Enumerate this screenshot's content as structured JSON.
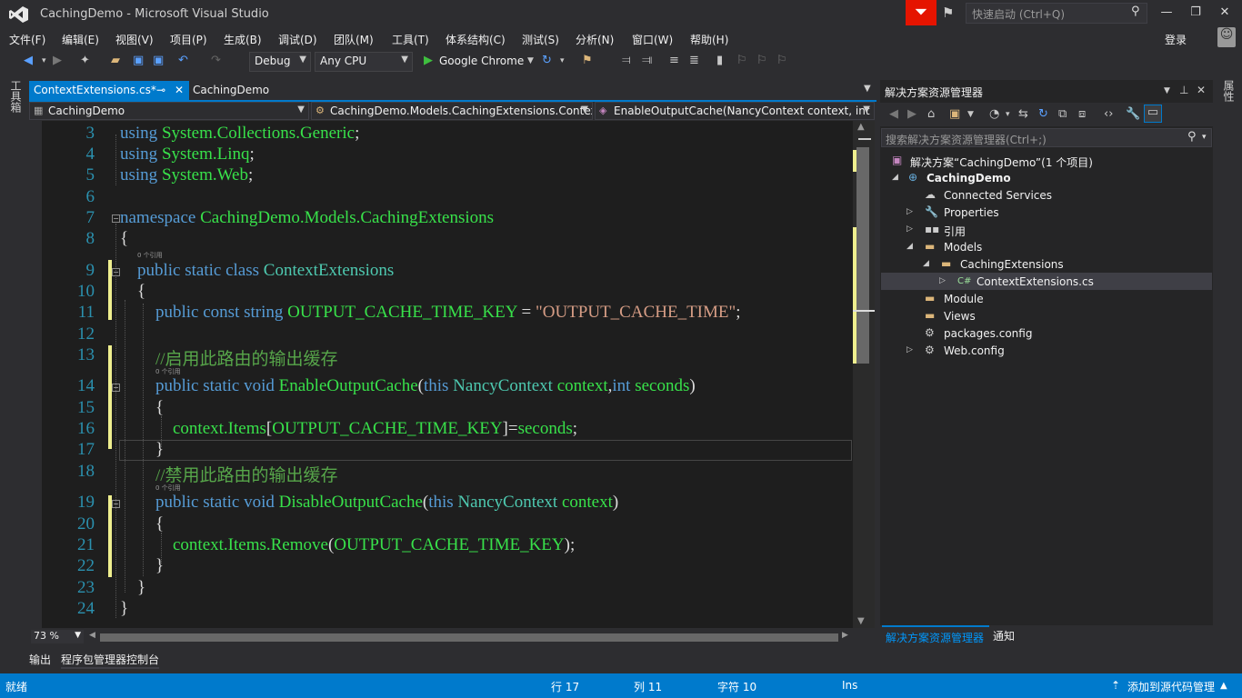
{
  "window": {
    "title": "CachingDemo - Microsoft Visual Studio",
    "quick_launch_placeholder": "快速启动 (Ctrl+Q)",
    "login": "登录"
  },
  "menu": [
    "文件(F)",
    "编辑(E)",
    "视图(V)",
    "项目(P)",
    "生成(B)",
    "调试(D)",
    "团队(M)",
    "工具(T)",
    "体系结构(C)",
    "测试(S)",
    "分析(N)",
    "窗口(W)",
    "帮助(H)"
  ],
  "toolbar": {
    "configuration": "Debug",
    "platform": "Any CPU",
    "run_target": "Google Chrome"
  },
  "left_strip": "工具箱",
  "right_strip": "属性",
  "doc_tabs": {
    "active": "ContextExtensions.cs*",
    "other": "CachingDemo"
  },
  "navbar": {
    "project": "CachingDemo",
    "type": "CachingDemo.Models.CachingExtensions.ContextExtensions",
    "member": "EnableOutputCache(NancyContext context, int seconds)"
  },
  "code": {
    "line_numbers": [
      "3",
      "4",
      "5",
      "6",
      "7",
      "8",
      "9",
      "10",
      "11",
      "12",
      "13",
      "14",
      "15",
      "16",
      "17",
      "18",
      "19",
      "20",
      "21",
      "22",
      "23",
      "24"
    ],
    "ref_label": "0 个引用",
    "using1_kw": "using",
    "using1_ns": "System.Collections.Generic",
    "using1_end": ";",
    "using2_kw": "using",
    "using2_ns": "System.Linq",
    "using2_end": ";",
    "using3_kw": "using",
    "using3_ns": "System.Web",
    "using3_end": ";",
    "ns_kw": "namespace",
    "ns_name": "CachingDemo.Models.CachingExtensions",
    "brace_open": "{",
    "brace_close": "}",
    "class_kw": "public static class",
    "class_name": "ContextExtensions",
    "const_kw": "public const string",
    "const_name": "OUTPUT_CACHE_TIME_KEY",
    "const_eq": " = ",
    "const_val": "\"OUTPUT_CACHE_TIME\"",
    "const_end": ";",
    "comment_enable": "//启用此路由的输出缓存",
    "enable_kw": "public static void",
    "enable_name": "EnableOutputCache",
    "enable_p1": "(",
    "enable_this": "this",
    "enable_type": "NancyContext",
    "enable_ctx": "context",
    "enable_comma": ",",
    "enable_int": "int",
    "enable_sec": "seconds",
    "enable_close": ")",
    "body_ctx": "context.Items",
    "body_br": "[",
    "body_key": "OUTPUT_CACHE_TIME_KEY",
    "body_assign": "]=",
    "body_sec": "seconds",
    "body_end": ";",
    "comment_disable": "//禁用此路由的输出缓存",
    "disable_kw": "public static void",
    "disable_name": "DisableOutputCache",
    "disable_p1": "(",
    "disable_this": "this",
    "disable_type": "NancyContext",
    "disable_ctx": "context",
    "disable_close": ")",
    "remove_call": "context.Items.Remove",
    "remove_p": "(",
    "remove_key": "OUTPUT_CACHE_TIME_KEY",
    "remove_end": ");"
  },
  "zoom": "73 %",
  "solution_explorer": {
    "title": "解决方案资源管理器",
    "search_placeholder": "搜索解决方案资源管理器(Ctrl+;)",
    "tree": [
      "解决方案“CachingDemo”(1 个项目)",
      "CachingDemo",
      "Connected Services",
      "Properties",
      "引用",
      "Models",
      "CachingExtensions",
      "ContextExtensions.cs",
      "Module",
      "Views",
      "packages.config",
      "Web.config"
    ],
    "bottom_tabs": [
      "解决方案资源管理器",
      "通知"
    ]
  },
  "bottom_tabs": [
    "输出",
    "程序包管理器控制台"
  ],
  "status": {
    "state": "就绪",
    "row": "行 17",
    "col": "列 11",
    "char": "字符 10",
    "mode": "Ins",
    "source_control": "添加到源代码管理"
  },
  "colors": {
    "accent": "#007acc",
    "keyword": "#569cd6",
    "type": "#4ec9b0",
    "identifier_green": "#38e14a",
    "string": "#d69d85",
    "comment": "#57a64a",
    "line_number": "#2b91af"
  }
}
